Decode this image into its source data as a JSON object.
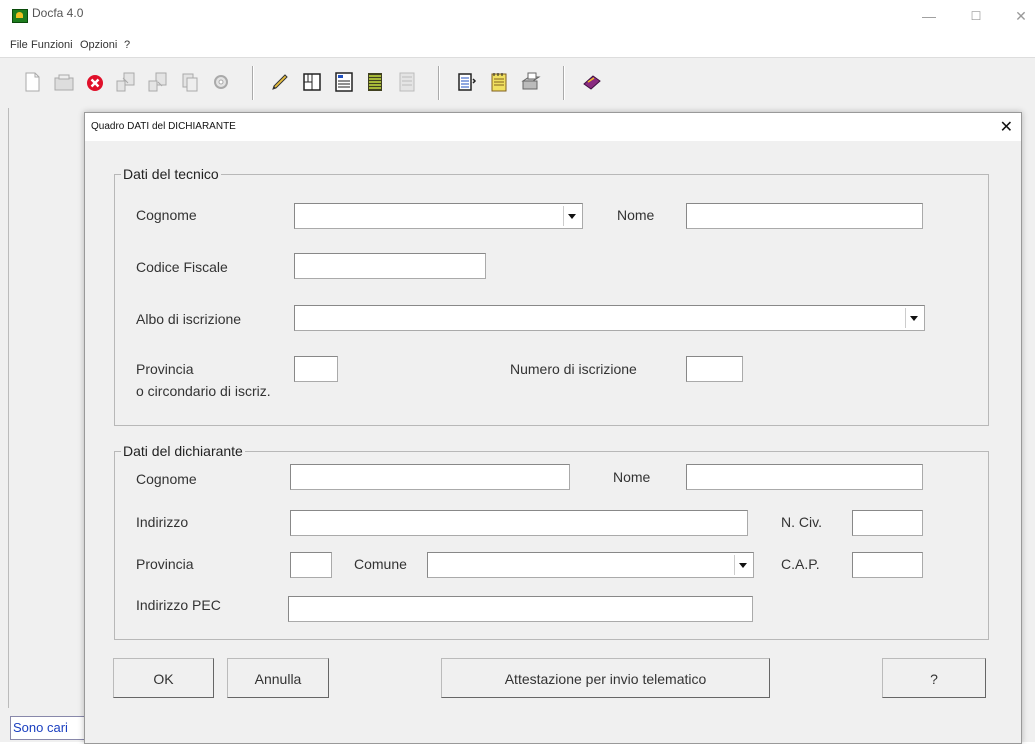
{
  "app": {
    "title": "Docfa 4.0",
    "minimize": "—",
    "maximize": "☐",
    "close": "✕"
  },
  "menu": [
    "File",
    "Funzioni",
    "Opzioni",
    "?"
  ],
  "status": {
    "text": "Sono cari"
  },
  "dialog": {
    "title": "Quadro DATI del DICHIARANTE",
    "close": "✕",
    "tecnico": {
      "legend": "Dati del tecnico",
      "cognome_label": "Cognome",
      "cognome_value": "",
      "nome_label": "Nome",
      "nome_value": "",
      "codice_fiscale_label": "Codice Fiscale",
      "codice_fiscale_value": "",
      "albo_label": "Albo di iscrizione",
      "albo_value": "",
      "provincia_label": "Provincia",
      "provincia_label2": "o circondario di iscriz.",
      "provincia_value": "",
      "numero_label": "Numero di iscrizione",
      "numero_value": ""
    },
    "dichiarante": {
      "legend": "Dati del dichiarante",
      "cognome_label": "Cognome",
      "cognome_value": "",
      "nome_label": "Nome",
      "nome_value": "",
      "indirizzo_label": "Indirizzo",
      "indirizzo_value": "",
      "ncivico_label": "N. Civ.",
      "ncivico_value": "",
      "provincia_label": "Provincia",
      "provincia_value": "",
      "comune_label": "Comune",
      "comune_value": "",
      "cap_label": "C.A.P.",
      "cap_value": "",
      "pec_label": "Indirizzo PEC",
      "pec_value": ""
    },
    "buttons": {
      "ok": "OK",
      "annulla": "Annulla",
      "attestazione": "Attestazione per invio telematico",
      "help": "?"
    }
  },
  "colors": {
    "window_bg": "#f0f0f0",
    "status_text": "#1a3fc0",
    "close_icon_red": "#e0102a"
  }
}
